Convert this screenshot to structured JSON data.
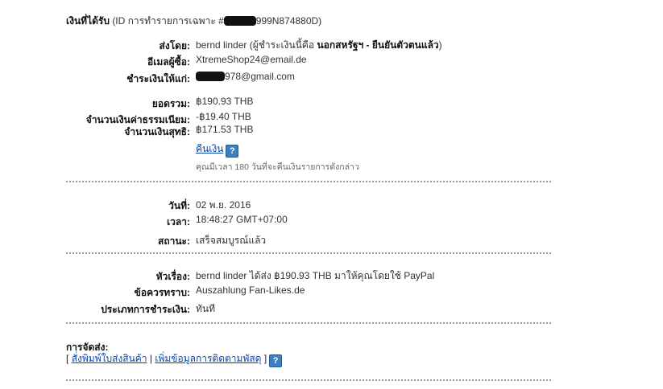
{
  "header": {
    "title": "เงินที่ได้รับ",
    "id_prefix": "(ID การทำรายการเฉพาะ #",
    "id_suffix": "999N874880D)"
  },
  "sender": {
    "label": "ส่งโดย:",
    "name": "bernd linder",
    "note_prefix": "(ผู้ชำระเงินนี้คือ",
    "note_bold": "นอกสหรัฐฯ - ยืนยันตัวตนแล้ว",
    "note_suffix": ")"
  },
  "buyer_email": {
    "label": "อีเมลผู้ซื้อ:",
    "value": "XtremeShop24@email.de"
  },
  "payee": {
    "label": "ชำระเงินให้แก่:",
    "value_suffix": "978@gmail.com"
  },
  "amounts": {
    "total_label": "ยอดรวม:",
    "total_value": "฿190.93 THB",
    "fee_label": "จำนวนเงินค่าธรรมเนียม:",
    "fee_value": "-฿19.40 THB",
    "net_label": "จำนวนเงินสุทธิ:",
    "net_value": "฿171.53 THB"
  },
  "refund": {
    "link_label": "คืนเงิน",
    "help_glyph": "?",
    "note": "คุณมีเวลา 180 วันที่จะคืนเงินรายการดังกล่าว"
  },
  "details": {
    "date_label": "วันที่:",
    "date_value": "02 พ.ย. 2016",
    "time_label": "เวลา:",
    "time_value": "18:48:27 GMT+07:00",
    "status_label": "สถานะ:",
    "status_value": "เสร็จสมบูรณ์แล้ว"
  },
  "message": {
    "subject_label": "หัวเรื่อง:",
    "subject_value": "bernd linder ได้ส่ง ฿190.93 THB มาให้คุณโดยใช้ PayPal",
    "note_label": "ข้อควรทราบ:",
    "note_value": "Auszahlung Fan-Likes.de",
    "type_label": "ประเภทการชำระเงิน:",
    "type_value": "ทันที"
  },
  "shipping": {
    "title": "การจัดส่ง:",
    "open_bracket": "[",
    "print_label_link": "สั่งพิมพ์ใบส่งสินค้า",
    "divider": "|",
    "add_tracking_link": "เพิ่มข้อมูลการติดตามพัสดุ",
    "close_bracket": "]",
    "help_glyph": "?"
  }
}
